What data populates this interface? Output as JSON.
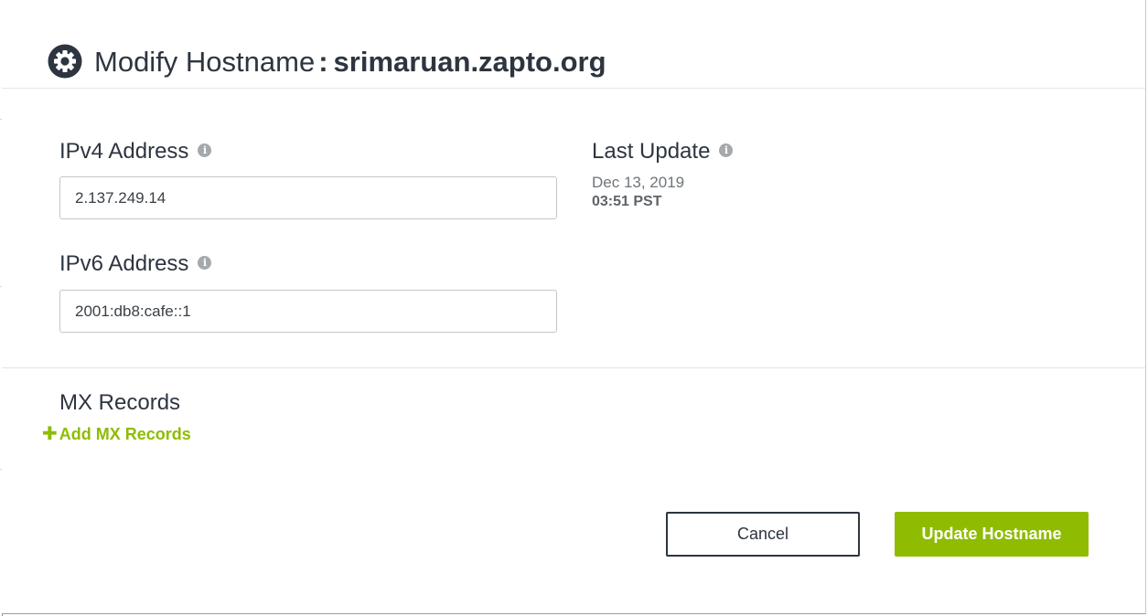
{
  "dialog": {
    "title_prefix": "Modify Hostname",
    "title_separator": ":",
    "hostname": "srimaruan.zapto.org"
  },
  "ipv4": {
    "label": "IPv4 Address",
    "value": "2.137.249.14"
  },
  "ipv6": {
    "label": "IPv6 Address",
    "value": "2001:db8:cafe::1"
  },
  "last_update": {
    "label": "Last Update",
    "date": "Dec 13, 2019",
    "time": "03:51 PST"
  },
  "mx": {
    "heading": "MX Records",
    "add_link": "Add MX Records",
    "add_icon": "plus-icon"
  },
  "buttons": {
    "cancel": "Cancel",
    "update": "Update Hostname"
  },
  "icons": {
    "title": "gear-icon",
    "info": "info-icon"
  },
  "colors": {
    "accent": "#8fbc00",
    "text": "#2d3540"
  }
}
